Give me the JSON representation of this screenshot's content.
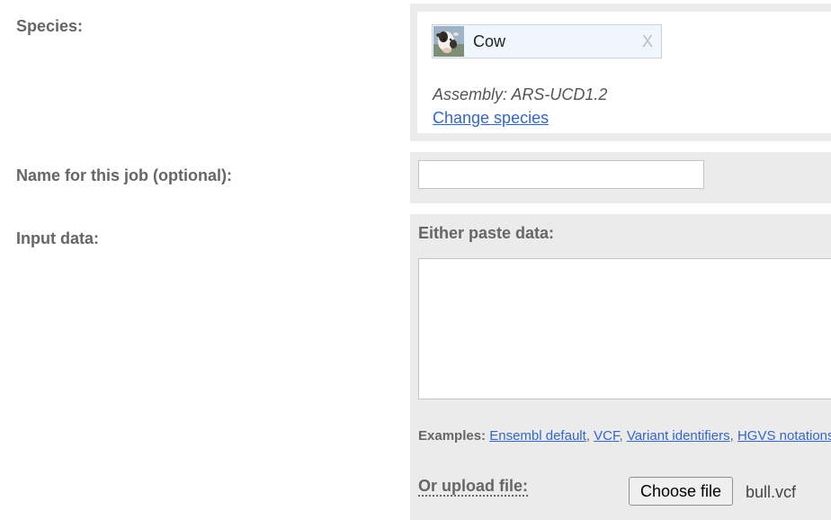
{
  "form": {
    "species_label": "Species:",
    "job_name_label": "Name for this job (optional):",
    "input_data_label": "Input data:"
  },
  "species": {
    "selected": "Cow",
    "remove_symbol": "X",
    "assembly": "Assembly: ARS-UCD1.2",
    "change_link": "Change species",
    "thumbnail_icon": "cow-icon"
  },
  "job_name": {
    "value": "",
    "placeholder": ""
  },
  "input_data": {
    "paste_heading": "Either paste data:",
    "paste_value": "",
    "examples_label": "Examples:",
    "examples": [
      "Ensembl default",
      "VCF",
      "Variant identifiers",
      "HGVS notations"
    ],
    "upload_label": "Or upload file:",
    "choose_file_label": "Choose file",
    "file_name": "bull.vcf"
  },
  "colors": {
    "panel_background": "#ebebeb",
    "link": "#3366cc",
    "label_text": "#666666",
    "chip_background": "#f0f6fd"
  }
}
